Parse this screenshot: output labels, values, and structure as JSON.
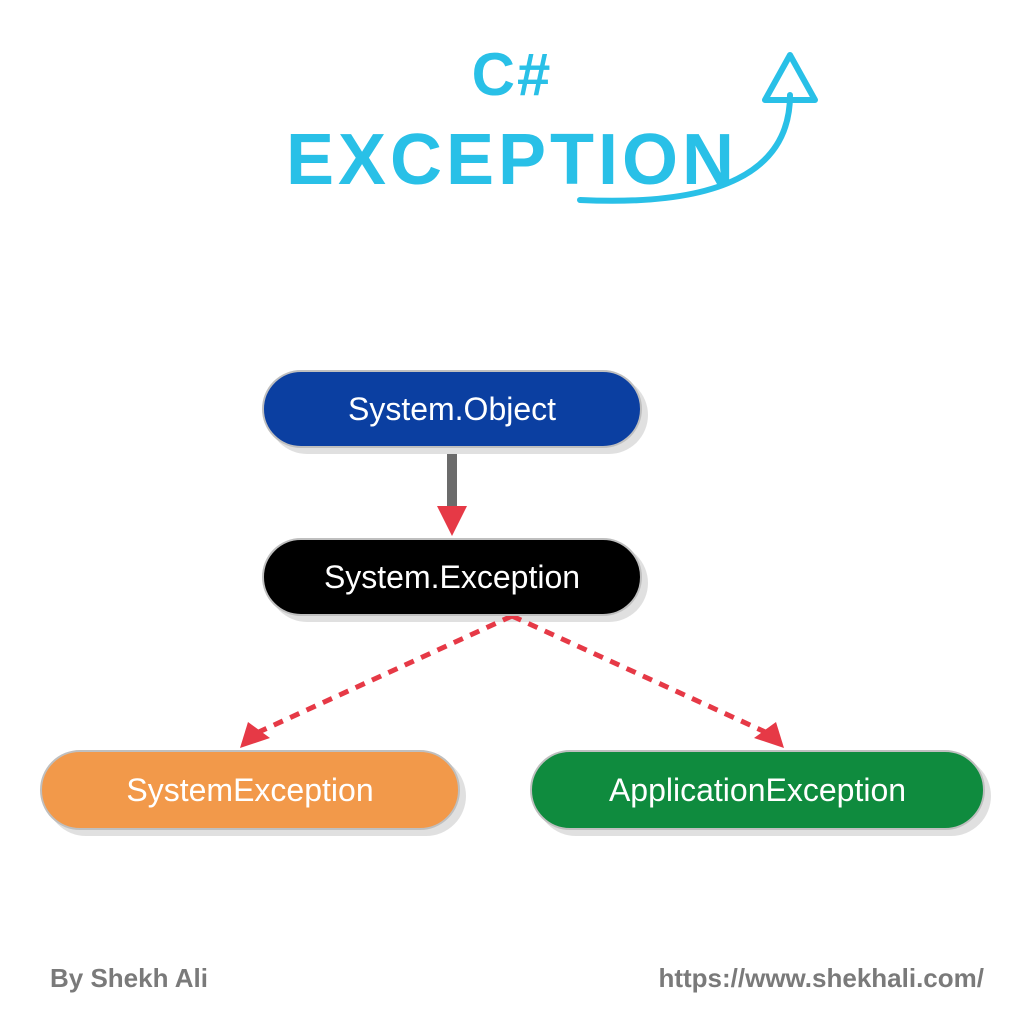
{
  "title": {
    "line1": "C#",
    "line2": "EXCEPTION"
  },
  "nodes": {
    "object": "System.Object",
    "exception": "System.Exception",
    "systemException": "SystemException",
    "applicationException": "ApplicationException"
  },
  "footer": {
    "author": "By Shekh Ali",
    "url": "https://www.shekhali.com/"
  },
  "colors": {
    "title": "#29c0e7",
    "nodeObject": "#0b3fa1",
    "nodeException": "#000000",
    "nodeSystem": "#f2994a",
    "nodeApplication": "#0f8b3e",
    "arrowRed": "#e63946",
    "footerGrey": "#7a7a7a"
  }
}
